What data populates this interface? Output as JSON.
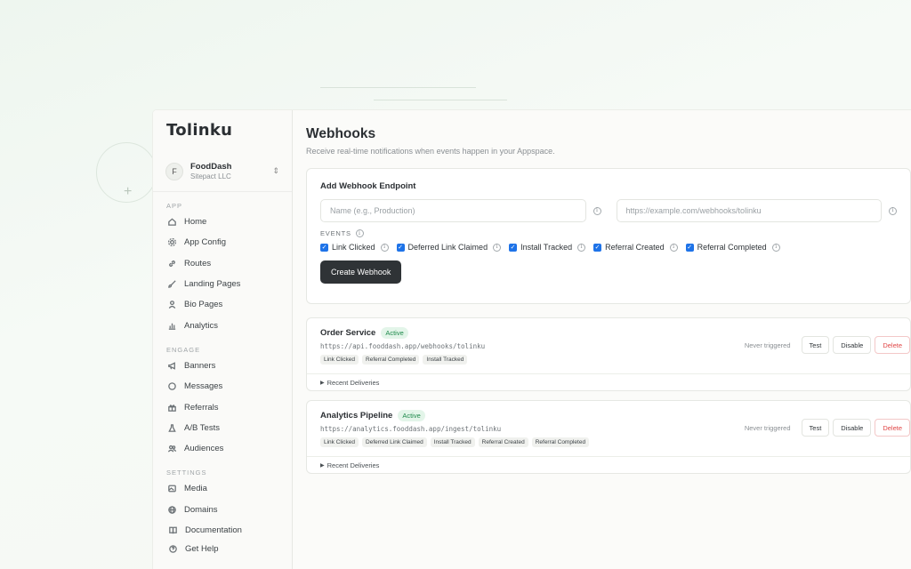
{
  "brand": {
    "logo_text": "Tolinku"
  },
  "workspace": {
    "avatar": "F",
    "name": "FoodDash",
    "org": "Sitepact LLC",
    "switch_icon": "chevron-up-down-icon"
  },
  "sidebar": {
    "sections": [
      {
        "label": "APP",
        "items": [
          {
            "label": "Home",
            "icon": "home-icon"
          },
          {
            "label": "App Config",
            "icon": "gear-icon"
          },
          {
            "label": "Routes",
            "icon": "link-icon"
          },
          {
            "label": "Landing Pages",
            "icon": "brush-icon"
          },
          {
            "label": "Bio Pages",
            "icon": "user-icon"
          },
          {
            "label": "Analytics",
            "icon": "bar-chart-icon"
          }
        ]
      },
      {
        "label": "ENGAGE",
        "items": [
          {
            "label": "Banners",
            "icon": "megaphone-icon"
          },
          {
            "label": "Messages",
            "icon": "chat-icon"
          },
          {
            "label": "Referrals",
            "icon": "gift-icon"
          },
          {
            "label": "A/B Tests",
            "icon": "flask-icon"
          },
          {
            "label": "Audiences",
            "icon": "users-icon"
          }
        ]
      },
      {
        "label": "SETTINGS",
        "items": [
          {
            "label": "Media",
            "icon": "image-icon"
          },
          {
            "label": "Domains",
            "icon": "globe-icon"
          }
        ]
      }
    ],
    "bottom": [
      {
        "label": "Documentation",
        "icon": "book-icon"
      },
      {
        "label": "Get Help",
        "icon": "help-icon"
      }
    ]
  },
  "page": {
    "title": "Webhooks",
    "subtitle": "Receive real-time notifications when events happen in your Appspace."
  },
  "add_form": {
    "title": "Add Webhook Endpoint",
    "name_placeholder": "Name (e.g., Production)",
    "url_placeholder": "https://example.com/webhooks/tolinku",
    "events_label": "EVENTS",
    "events": [
      "Link Clicked",
      "Deferred Link Claimed",
      "Install Tracked",
      "Referral Created",
      "Referral Completed"
    ],
    "create_label": "Create Webhook"
  },
  "webhooks": [
    {
      "name": "Order Service",
      "status": "Active",
      "url": "https://api.fooddash.app/webhooks/tolinku",
      "events": [
        "Link Clicked",
        "Referral Completed",
        "Install Tracked"
      ],
      "last": "Never triggered",
      "test": "Test",
      "disable": "Disable",
      "delete": "Delete",
      "deliveries": "Recent Deliveries"
    },
    {
      "name": "Analytics Pipeline",
      "status": "Active",
      "url": "https://analytics.fooddash.app/ingest/tolinku",
      "events": [
        "Link Clicked",
        "Deferred Link Claimed",
        "Install Tracked",
        "Referral Created",
        "Referral Completed"
      ],
      "last": "Never triggered",
      "test": "Test",
      "disable": "Disable",
      "delete": "Delete",
      "deliveries": "Recent Deliveries"
    }
  ],
  "colors": {
    "accent": "#1e73e8",
    "active_text": "#1f8a4c",
    "delete": "#e04646",
    "primary_button": "#2f3336"
  }
}
